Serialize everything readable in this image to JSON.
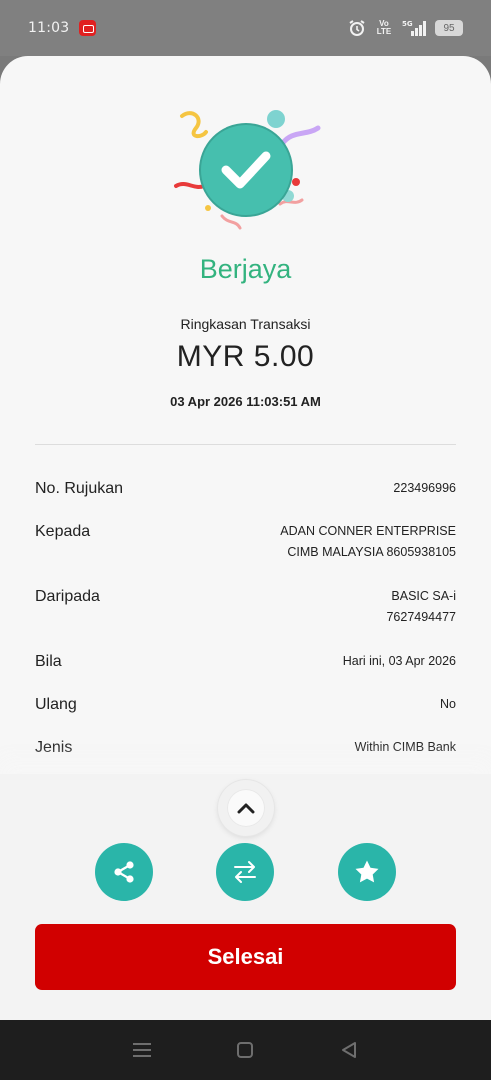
{
  "status_bar": {
    "time": "11:03",
    "network": "5G",
    "volte": "Vo LTE",
    "battery": "95"
  },
  "result": {
    "title": "Berjaya",
    "summary_label": "Ringkasan Transaksi",
    "amount": "MYR 5.00",
    "datetime": "03 Apr 2026 11:03:51 AM"
  },
  "details": [
    {
      "label": "No. Rujukan",
      "value": [
        "223496996"
      ]
    },
    {
      "label": "Kepada",
      "value": [
        "ADAN CONNER ENTERPRISE",
        "CIMB MALAYSIA 8605938105"
      ]
    },
    {
      "label": "Daripada",
      "value": [
        "BASIC SA-i",
        "7627494477"
      ]
    },
    {
      "label": "Bila",
      "value": [
        "Hari ini, 03 Apr 2026"
      ]
    },
    {
      "label": "Ulang",
      "value": [
        "No"
      ]
    },
    {
      "label": "Jenis",
      "value": [
        "Within CIMB Bank"
      ]
    }
  ],
  "actions": {
    "share_icon": "share-icon",
    "repeat_icon": "transfer-arrows-icon",
    "favourite_icon": "star-icon",
    "done_label": "Selesai"
  },
  "colors": {
    "success_green": "#33b37f",
    "teal": "#2ab5a9",
    "primary_red": "#d10000"
  }
}
